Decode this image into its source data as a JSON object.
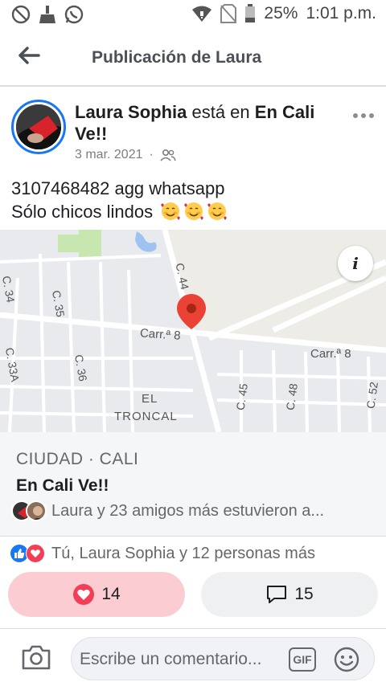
{
  "status_bar": {
    "battery": "25%",
    "time": "1:01 p.m.",
    "icons": [
      "blocked-icon",
      "broom-icon",
      "whatsapp-icon",
      "wifi-icon",
      "no-sim-icon",
      "battery-icon"
    ]
  },
  "header": {
    "title": "Publicación de Laura"
  },
  "post": {
    "author": "Laura Sophia",
    "at_text": "está en",
    "place": "En Cali Ve!!",
    "date": "3 mar. 2021",
    "separator": "·",
    "text_line1": "3107468482 agg whatsapp",
    "text_line2": "Sólo chicos lindos",
    "emoji_count": 3
  },
  "map": {
    "labels": [
      "C. 44",
      "Carr.ª 8",
      "Carr.ª 8",
      "C. 34",
      "C. 35",
      "C. 36",
      "C. 33A",
      "EL",
      "TRONCAL",
      "C. 45",
      "C. 48",
      "C. 52"
    ],
    "info_label": "i"
  },
  "place_card": {
    "category": "CIUDAD · CALI",
    "name": "En Cali Ve!!",
    "friends_text": "Laura y 23 amigos más estuvieron a..."
  },
  "reactions": {
    "text": "Tú, Laura Sophia y 12 personas más"
  },
  "actions": {
    "love_count": "14",
    "comment_count": "15"
  },
  "comment_bar": {
    "placeholder": "Escribe un comentario...",
    "gif_label": "GIF"
  },
  "colors": {
    "accent": "#1877f2",
    "love": "#f33e58",
    "map_pin": "#ea4335"
  }
}
